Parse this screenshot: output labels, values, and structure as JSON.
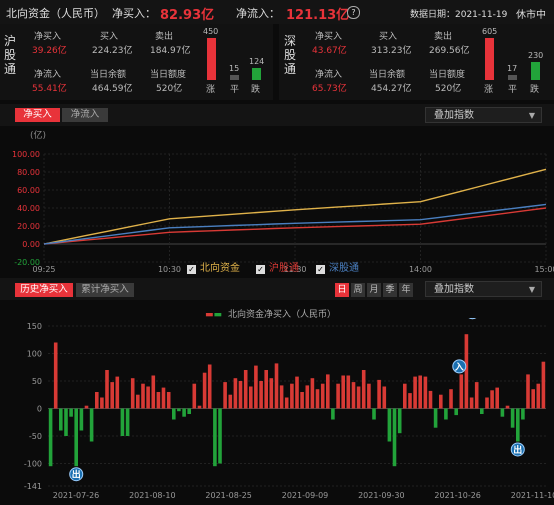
{
  "header": {
    "title": "北向资金（人民币）",
    "net_buy_label": "净买入：",
    "net_buy_value": "82.93亿",
    "net_inflow_label": "净流入：",
    "net_inflow_value": "121.13亿",
    "help_icon": "?",
    "date_label": "数据日期：2021-11-19",
    "status": "休市中"
  },
  "sh": {
    "name": "沪股通",
    "net_buy_label": "净买入",
    "net_buy": "39.26亿",
    "buy_label": "买入",
    "buy": "224.23亿",
    "sell_label": "卖出",
    "sell": "184.97亿",
    "net_inflow_label": "净流入",
    "net_inflow": "55.41亿",
    "balance_label": "当日余额",
    "balance": "464.59亿",
    "quota_label": "当日额度",
    "quota": "520亿",
    "up": "450",
    "flat": "15",
    "down": "124",
    "up_label": "涨",
    "flat_label": "平",
    "down_label": "跌"
  },
  "sz": {
    "name": "深股通",
    "net_buy_label": "净买入",
    "net_buy": "43.67亿",
    "buy_label": "买入",
    "buy": "313.23亿",
    "sell_label": "卖出",
    "sell": "269.56亿",
    "net_inflow_label": "净流入",
    "net_inflow": "65.73亿",
    "balance_label": "当日余额",
    "balance": "454.27亿",
    "quota_label": "当日额度",
    "quota": "520亿",
    "up": "605",
    "flat": "17",
    "down": "230",
    "up_label": "涨",
    "flat_label": "平",
    "down_label": "跌"
  },
  "intraday": {
    "tabs": [
      "净买入",
      "净流入"
    ],
    "overlay": "叠加指数",
    "unit": "(亿)",
    "legend": [
      "北向资金",
      "沪股通",
      "深股通"
    ],
    "colors": {
      "north": "#e0b24a",
      "sh": "#d83a35",
      "sz": "#4a7fc0"
    }
  },
  "history": {
    "tabs": [
      "历史净买入",
      "累计净买入"
    ],
    "periods": [
      "日",
      "周",
      "月",
      "季",
      "年"
    ],
    "overlay": "叠加指数",
    "legend": "北向资金净买入（人民币）",
    "marker_in": "入",
    "marker_out": "出"
  },
  "chart_data": [
    {
      "type": "line",
      "ylabel": "(亿)",
      "ylim": [
        -20,
        100
      ],
      "yticks": [
        "100.00",
        "80.00",
        "60.00",
        "40.00",
        "20.00",
        "0.00",
        "-20.00"
      ],
      "xticks": [
        "09:25",
        "10:30",
        "11:30",
        "14:00",
        "15:00"
      ],
      "x": [
        0,
        1,
        2,
        3,
        4
      ],
      "series": [
        {
          "name": "北向资金",
          "values": [
            0,
            28,
            38,
            47,
            83
          ]
        },
        {
          "name": "沪股通",
          "values": [
            0,
            13,
            18,
            22,
            40
          ]
        },
        {
          "name": "深股通",
          "values": [
            0,
            18,
            23,
            27,
            44
          ]
        }
      ]
    },
    {
      "type": "bar",
      "title": "北向资金净买入（人民币）",
      "ylim": [
        -141,
        150
      ],
      "yticks": [
        "150",
        "100",
        "50",
        "0",
        "-50",
        "-100",
        "-141"
      ],
      "xticks": [
        "2021-07-26",
        "2021-08-10",
        "2021-08-25",
        "2021-09-09",
        "2021-09-30",
        "2021-10-26",
        "2021-11-10"
      ],
      "values": [
        -105,
        120,
        -40,
        -50,
        -15,
        -105,
        -40,
        5,
        -60,
        30,
        20,
        70,
        48,
        58,
        -50,
        -50,
        55,
        25,
        45,
        40,
        60,
        30,
        38,
        30,
        -20,
        -5,
        -15,
        -10,
        45,
        5,
        65,
        80,
        -105,
        -100,
        48,
        25,
        55,
        50,
        70,
        40,
        78,
        50,
        70,
        55,
        82,
        42,
        20,
        45,
        58,
        30,
        42,
        55,
        35,
        45,
        62,
        -20,
        45,
        60,
        60,
        48,
        40,
        70,
        45,
        -20,
        52,
        40,
        -60,
        -105,
        -45,
        45,
        28,
        58,
        60,
        58,
        32,
        -35,
        25,
        -20,
        35,
        -12,
        62,
        135,
        20,
        48,
        -10,
        20,
        33,
        38,
        -15,
        5,
        -35,
        -60,
        -20,
        62,
        35,
        45,
        85
      ],
      "markers": [
        {
          "label": "入",
          "count": 2
        },
        {
          "label": "出",
          "count": 2
        }
      ]
    }
  ]
}
